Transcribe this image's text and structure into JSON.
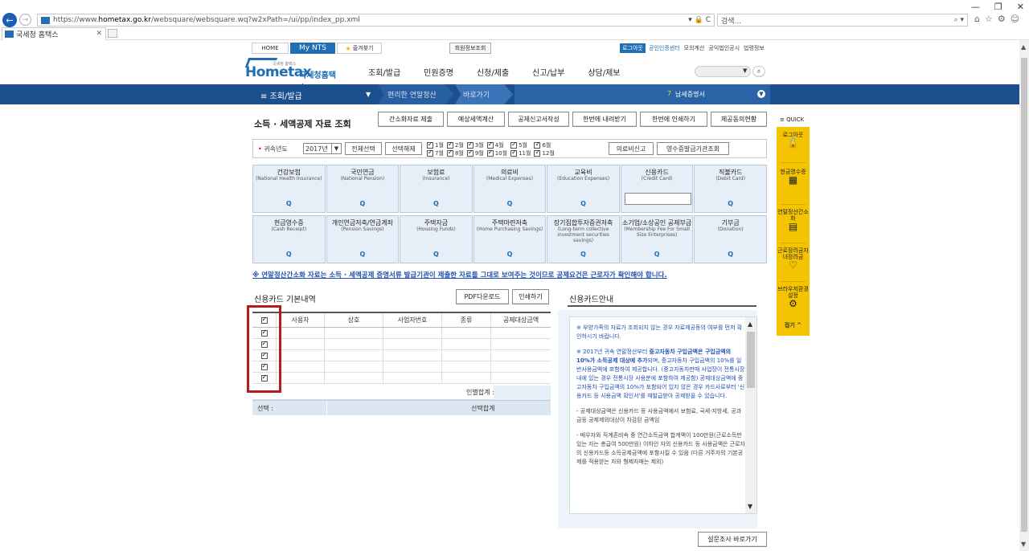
{
  "browser": {
    "url_prefix": "https://www.",
    "url_domain": "hometax.go.kr",
    "url_path": "/websquare/websquare.wq?w2xPath=/ui/pp/index_pp.xml",
    "url_controls": "▾ 🔒 C",
    "search_placeholder": "검색...",
    "search_controls": "⌕ ▾",
    "tab_title": "국세청 홈택스",
    "win_min": "—",
    "win_max": "❐",
    "win_close": "✕"
  },
  "topnav": {
    "home": "HOME",
    "mynts": "My NTS",
    "favorites": "즐겨찾기",
    "member_info": "회원정보조회",
    "logout": "로그아웃",
    "cert_center": "공인인증센터",
    "links": [
      "모의계산",
      "공익법인공시",
      "법령정보"
    ]
  },
  "logo": {
    "home": "Hometax",
    "korean": "국세청홈택스",
    "tiny": "국세청 홈택스"
  },
  "main_menu": [
    "조회/발급",
    "민원증명",
    "신청/제출",
    "신고/납부",
    "상담/제보"
  ],
  "bluebar": {
    "current": "≡  조회/발급",
    "breadcrumb1": "편리한 연말정산",
    "breadcrumb2": "바로가기",
    "num": "7",
    "item": "납세증명서"
  },
  "page": {
    "title": "소득 · 세액공제 자료 조회",
    "buttons": [
      "간소화자료 제출",
      "예상세액계산",
      "공제신고서작성",
      "한번에 내려받기",
      "한번에 인쇄하기",
      "제공동의현황"
    ]
  },
  "filter": {
    "label": "귀속년도",
    "year": "2017년",
    "select_all": "전체선택",
    "deselect": "선택해제",
    "months": [
      "1월",
      "7월",
      "2월",
      "8월",
      "3월",
      "9월",
      "4월",
      "10월",
      "5월",
      "11월",
      "6월",
      "12월"
    ],
    "medical_report": "의료비신고",
    "receipt_org": "영수증발급기관조회"
  },
  "categories_row1": [
    {
      "ko": "건강보험",
      "en": "(National Health Insurance)"
    },
    {
      "ko": "국민연금",
      "en": "(National Pension)"
    },
    {
      "ko": "보험료",
      "en": "(Insurance)"
    },
    {
      "ko": "의료비",
      "en": "(Medical Expenses)"
    },
    {
      "ko": "교육비",
      "en": "(Education Expenses)"
    },
    {
      "ko": "신용카드",
      "en": "(Credit Card)"
    },
    {
      "ko": "직불카드",
      "en": "(Debit Card)"
    }
  ],
  "categories_row2": [
    {
      "ko": "현금영수증",
      "en": "(Cash Receipt)"
    },
    {
      "ko": "개인연금저축/연금계좌",
      "en": "(Pension Savings)"
    },
    {
      "ko": "주택자금",
      "en": "(Housing Funds)"
    },
    {
      "ko": "주택마련저축",
      "en": "(Home Purchasing Savings)"
    },
    {
      "ko": "장기집합투자증권저축",
      "en": "(Long-term collective investment securities savings)"
    },
    {
      "ko": "소기업/소상공인 공제부금",
      "en": "(Membership Fee For Small Size Enterprises)"
    },
    {
      "ko": "기부금",
      "en": "(Donation)"
    }
  ],
  "search_glyph": "Q",
  "notice": "※ 연말정산간소화 자료는 소득 · 세액공제 증명서류 발급기관이 제출한 자료를 그대로 보여주는 것이므로 공제요건은 근로자가 확인해야 합니다.",
  "card_section": {
    "title": "신용카드 기본내역",
    "pdf_download": "PDF다운로드",
    "print": "인쇄하기",
    "columns": [
      "사용자",
      "상호",
      "사업자번호",
      "종류",
      "공제대상금액"
    ],
    "row_count_checked": 5,
    "subtotal_label": "인별합계 :",
    "selected_label": "선택 :",
    "selected_total": "선택합계"
  },
  "info": {
    "title": "신용카드안내",
    "p1": "※ 부양가족의 자료가 조회되지 않는 경우 자료제공동의 여부를 먼저 확인하시기 바랍니다.",
    "p2a": "※ 2017년 귀속 연말정산부터 ",
    "p2b": "중고자동차 구입금액은 구입금액의 10%가 소득공제 대상에 추가",
    "p2c": "되며, 중고자동차 구입금액의 10%를 일반사용금액에 포함하여 제공합니다. (중고자동차판매 사업장이 전통시장내에 있는 경우 전통시장 사용분에 포함하여 제공함) 공제대상금액에 중고자동차 구입금액의 10%가 포함되어 있지 않은 경우 카드사로부터 '신용카드 등 사용금액 확인서'를 재발급받아 공제받을 수 있습니다.",
    "p3": "- 공제대상금액은 신용카드 등 사용금액에서 보험료, 국세·지방세, 공과금등 공제제외대상이 차감된 금액임",
    "p4": "- 배우자와 직계존비속 중 연간소득금액 합계액이 100만원(근로소득만 있는 자는 총급여 500만원) 이하인 자의 신용카드 등 사용금액은 근로자의 신용카드등 소득공제금액에 포함시킬 수 있음 (다른 거주자의 기본공제를 적용받는 자와 형제자매는 제외)"
  },
  "survey_button": "설문조사 바로가기",
  "quick": {
    "header": "≡ QUICK",
    "items": [
      "로그아웃",
      "현금영수증",
      "연말정산간소화",
      "근로장려금자녀장려금",
      "브라우저환경설정"
    ],
    "close": "접기 ^"
  }
}
